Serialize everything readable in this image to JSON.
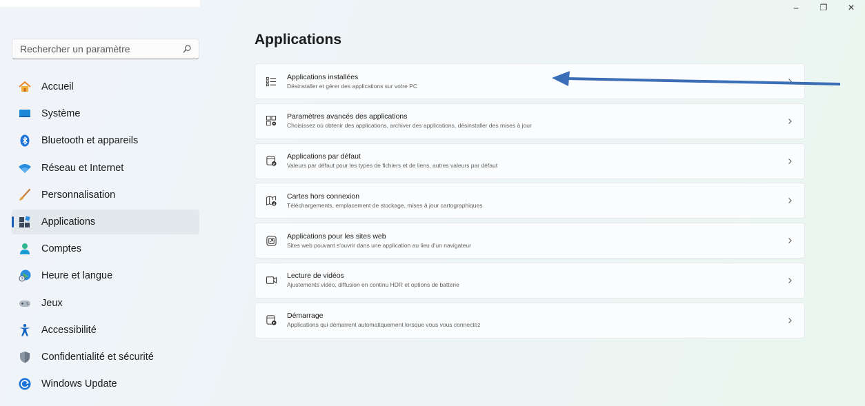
{
  "window": {
    "caption": {
      "minimize": "–",
      "restore": "❐",
      "close": "✕"
    }
  },
  "search": {
    "placeholder": "Rechercher un paramètre"
  },
  "sidebar": {
    "items": [
      {
        "label": "Accueil",
        "icon": "home-icon",
        "selected": false
      },
      {
        "label": "Système",
        "icon": "system-icon",
        "selected": false
      },
      {
        "label": "Bluetooth et appareils",
        "icon": "bluetooth-icon",
        "selected": false
      },
      {
        "label": "Réseau et Internet",
        "icon": "network-icon",
        "selected": false
      },
      {
        "label": "Personnalisation",
        "icon": "brush-icon",
        "selected": false
      },
      {
        "label": "Applications",
        "icon": "apps-icon",
        "selected": true
      },
      {
        "label": "Comptes",
        "icon": "account-icon",
        "selected": false
      },
      {
        "label": "Heure et langue",
        "icon": "globe-clock-icon",
        "selected": false
      },
      {
        "label": "Jeux",
        "icon": "gamepad-icon",
        "selected": false
      },
      {
        "label": "Accessibilité",
        "icon": "accessibility-icon",
        "selected": false
      },
      {
        "label": "Confidentialité et sécurité",
        "icon": "shield-icon",
        "selected": false
      },
      {
        "label": "Windows Update",
        "icon": "update-icon",
        "selected": false
      }
    ]
  },
  "main": {
    "title": "Applications",
    "cards": [
      {
        "title": "Applications installées",
        "desc": "Désinstaller et gérer des applications sur votre PC",
        "icon": "list-icon"
      },
      {
        "title": "Paramètres avancés des applications",
        "desc": "Choisissez où obtenir des applications, archiver des applications, désinstaller des mises à jour",
        "icon": "app-settings-icon"
      },
      {
        "title": "Applications par défaut",
        "desc": "Valeurs par défaut pour les types de fichiers et de liens, autres valeurs par défaut",
        "icon": "default-apps-icon"
      },
      {
        "title": "Cartes hors connexion",
        "desc": "Téléchargements, emplacement de stockage, mises à jour cartographiques",
        "icon": "offline-map-icon"
      },
      {
        "title": "Applications pour les sites web",
        "desc": "Sites web pouvant s'ouvrir dans une application au lieu d'un navigateur",
        "icon": "web-app-icon"
      },
      {
        "title": "Lecture de vidéos",
        "desc": "Ajustements vidéo, diffusion en continu HDR et options de batterie",
        "icon": "video-icon"
      },
      {
        "title": "Démarrage",
        "desc": "Applications qui démarrent automatiquement lorsque vous vous connectez",
        "icon": "startup-icon"
      }
    ]
  },
  "colors": {
    "accent": "#1a5fb4",
    "annotation_arrow": "#3a6fb8"
  }
}
